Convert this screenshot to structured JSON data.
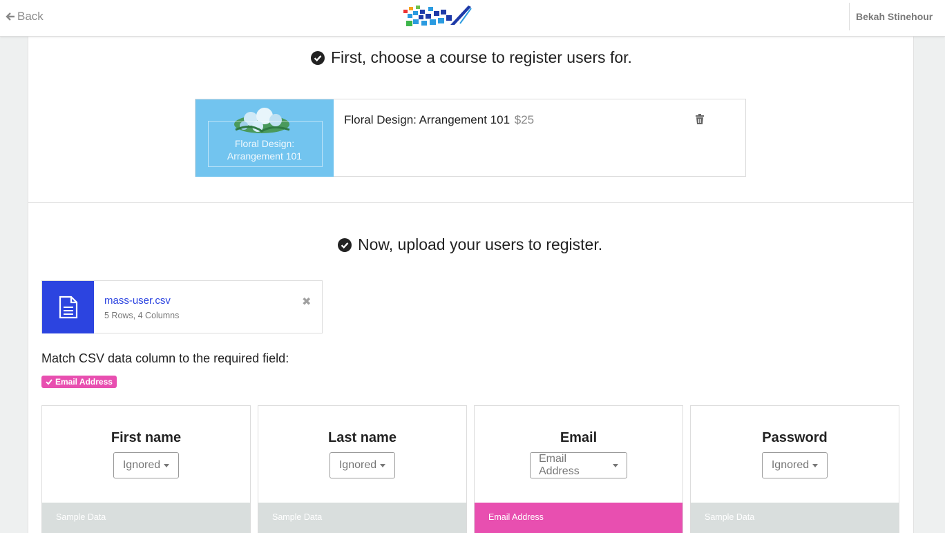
{
  "topbar": {
    "back_label": "Back",
    "user_name": "Bekah Stinehour"
  },
  "step1": {
    "heading": "First, choose a course to register users for.",
    "course": {
      "thumb_line1": "Floral Design:",
      "thumb_line2": "Arrangement 101",
      "title": "Floral Design: Arrangement 101",
      "price": "$25"
    }
  },
  "step2": {
    "heading": "Now, upload your users to register.",
    "file": {
      "name": "mass-user.csv",
      "meta": "5 Rows, 4 Columns",
      "close_glyph": "✖"
    },
    "match_label": "Match CSV data column to the required field:",
    "required_badge": "Email Address",
    "columns": [
      {
        "title": "First name",
        "selected": "Ignored",
        "footer": "Sample Data",
        "active": false
      },
      {
        "title": "Last name",
        "selected": "Ignored",
        "footer": "Sample Data",
        "active": false
      },
      {
        "title": "Email",
        "selected": "Email Address",
        "footer": "Email Address",
        "active": true
      },
      {
        "title": "Password",
        "selected": "Ignored",
        "footer": "Sample Data",
        "active": false
      }
    ]
  },
  "colors": {
    "accent_pink": "#e84fb0",
    "file_blue": "#2c44e0",
    "thumb_blue": "#72c4ef",
    "footer_gray": "#d9dedd"
  },
  "icons": {
    "back": "arrow-left-icon",
    "check": "check-circle-icon",
    "trash": "trash-icon",
    "file": "document-icon",
    "close": "close-icon",
    "badge_check": "check-icon",
    "dropdown": "caret-down-icon"
  }
}
